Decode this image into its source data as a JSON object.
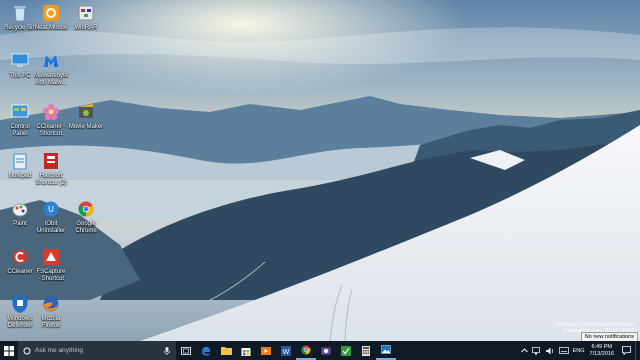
{
  "desktop": {
    "icons": [
      {
        "label": "Recycle Bin",
        "icon": "recycle-bin-icon"
      },
      {
        "label": "Neat Mouse",
        "icon": "neat-mouse-icon"
      },
      {
        "label": "WinRAR",
        "icon": "winrar-icon"
      },
      {
        "label": "This PC",
        "icon": "this-pc-icon"
      },
      {
        "label": "Malwarebyte\nAnti-Malw...",
        "icon": "malwarebytes-icon"
      },
      {
        "label": "Control\nPanel",
        "icon": "control-panel-icon"
      },
      {
        "label": "CCleaner -\nShortcut",
        "icon": "flower-icon"
      },
      {
        "label": "Movie Maker",
        "icon": "movie-maker-icon"
      },
      {
        "label": "Notepad",
        "icon": "notepad-icon"
      },
      {
        "label": "Hardsoft\nShortcut (2)",
        "icon": "hardsoft-icon"
      },
      {
        "label": "Paint",
        "icon": "paint-icon"
      },
      {
        "label": "IObit\nUninstaller",
        "icon": "iobit-uninstaller-icon"
      },
      {
        "label": "Google\nChrome",
        "icon": "chrome-icon"
      },
      {
        "label": "CCleaner",
        "icon": "ccleaner-icon"
      },
      {
        "label": "FSCapture\n- Shortcut",
        "icon": "fscapture-icon"
      },
      {
        "label": "Windows\nDefender",
        "icon": "windows-defender-icon"
      },
      {
        "label": "Mozilla\nFirefox",
        "icon": "firefox-icon"
      }
    ],
    "watermark_line1": "Windows 10 Pro Insider Preview",
    "watermark_line2": "Evaluation copy. Build 14393"
  },
  "notification_toast": "No new notifications",
  "taskbar": {
    "search_placeholder": "Ask me anything",
    "apps": [
      "task-view-icon",
      "edge-icon",
      "file-explorer-icon",
      "store-icon",
      "media-icon",
      "word-icon",
      "chrome-icon",
      "screenshot-icon",
      "green-app-icon",
      "calculator-icon",
      "photos-icon"
    ],
    "language": "ENG",
    "time": "6:49 PM",
    "date": "7/13/2016"
  }
}
